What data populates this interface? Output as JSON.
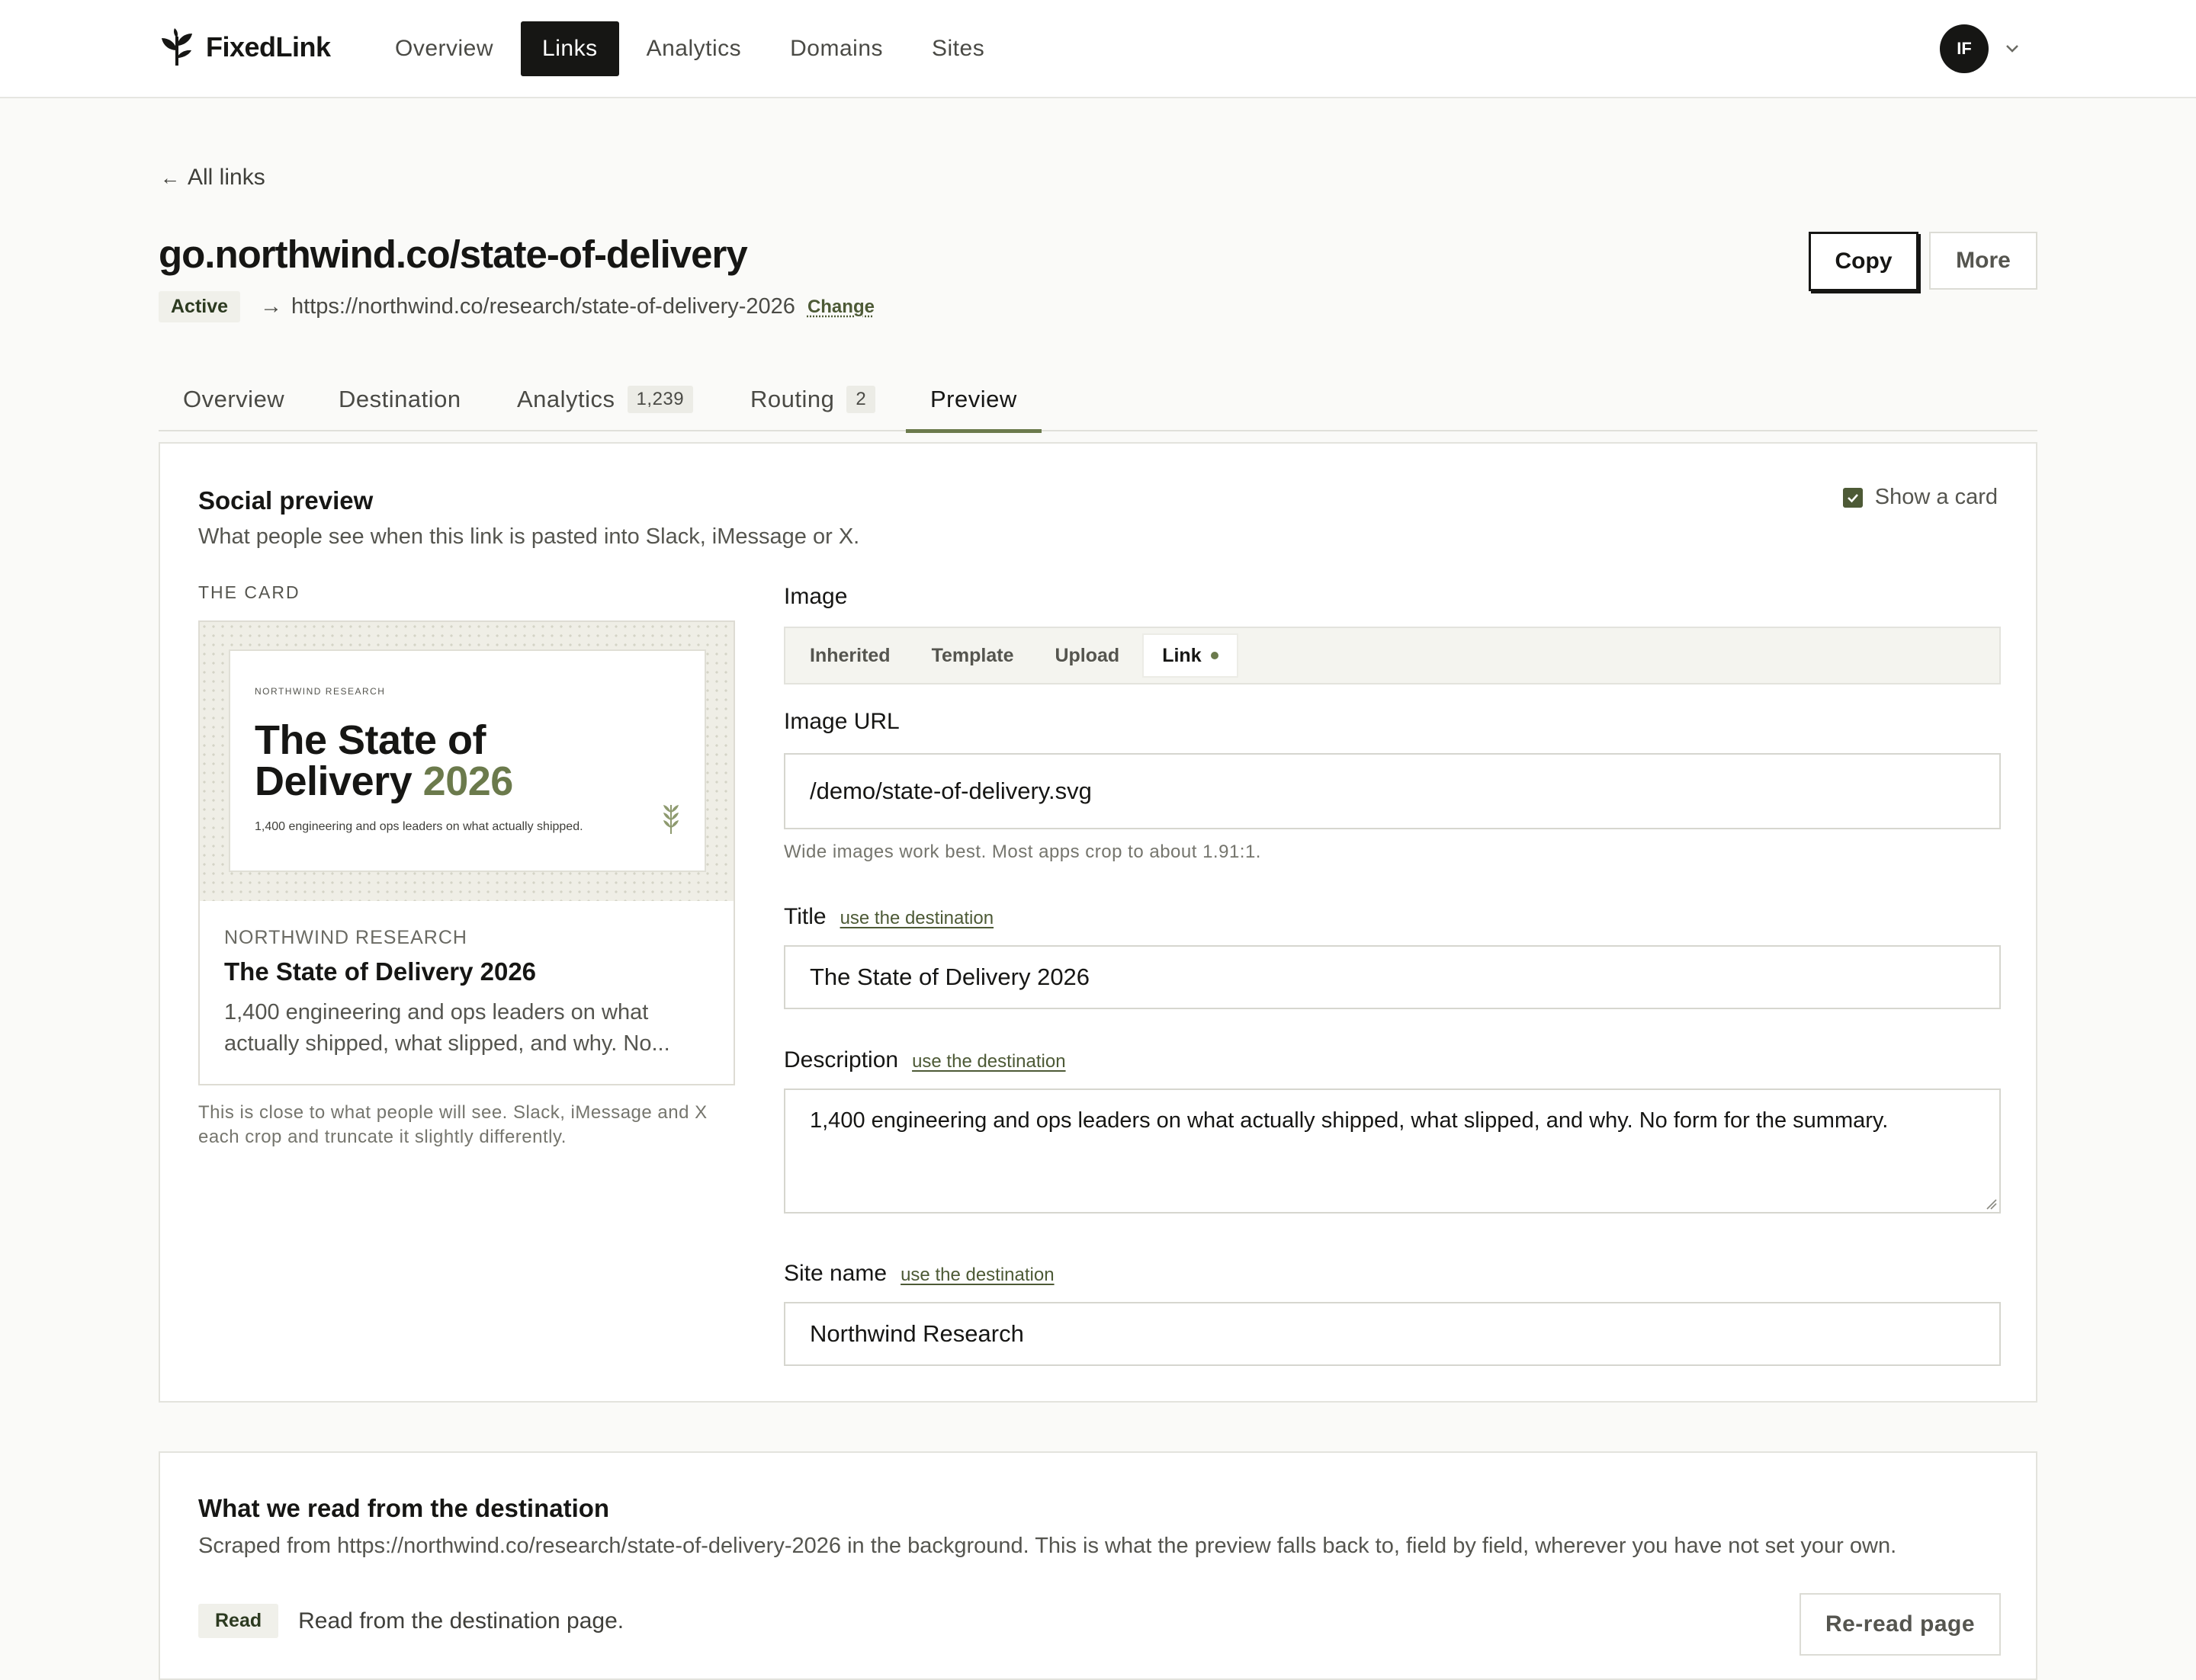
{
  "brand": {
    "name": "FixedLink",
    "accent": "#6b7a4c",
    "dark": "#161614"
  },
  "nav": {
    "items": [
      {
        "label": "Overview",
        "active": false
      },
      {
        "label": "Links",
        "active": true
      },
      {
        "label": "Analytics",
        "active": false
      },
      {
        "label": "Domains",
        "active": false
      },
      {
        "label": "Sites",
        "active": false
      }
    ]
  },
  "user": {
    "initials": "IF"
  },
  "back": {
    "arrow": "←",
    "label": "All links"
  },
  "link": {
    "short_url": "go.northwind.co/state-of-delivery",
    "status": "Active",
    "arrow": "→",
    "destination": "https://northwind.co/research/state-of-delivery-2026",
    "change_label": "Change"
  },
  "actions": {
    "copy": "Copy",
    "more": "More"
  },
  "tabs": [
    {
      "label": "Overview",
      "count": null
    },
    {
      "label": "Destination",
      "count": null
    },
    {
      "label": "Analytics",
      "count": "1,239"
    },
    {
      "label": "Routing",
      "count": "2"
    },
    {
      "label": "Preview",
      "count": null,
      "active": true
    }
  ],
  "social": {
    "title": "Social preview",
    "subtitle": "What people see when this link is pasted into Slack, iMessage or X.",
    "show_card_label": "Show a card",
    "show_card_checked": true,
    "card_label": "THE CARD",
    "card": {
      "image_kicker": "NORTHWIND RESEARCH",
      "image_title_line1": "The State of",
      "image_title_line2": "Delivery",
      "image_title_year": "2026",
      "image_subtitle": "1,400 engineering and ops leaders on what actually shipped.",
      "site": "NORTHWIND RESEARCH",
      "title": "The State of Delivery 2026",
      "description": "1,400 engineering and ops leaders on what actually shipped, what slipped, and why. No..."
    },
    "card_note": "This is close to what people will see. Slack, iMessage and X each crop and truncate it slightly differently.",
    "image_label": "Image",
    "image_sources": [
      {
        "label": "Inherited",
        "active": false
      },
      {
        "label": "Template",
        "active": false
      },
      {
        "label": "Upload",
        "active": false
      },
      {
        "label": "Link",
        "active": true
      }
    ],
    "image_url_label": "Image URL",
    "image_url": "/demo/state-of-delivery.svg",
    "image_hint": "Wide images work best. Most apps crop to about 1.91:1.",
    "title_label": "Title",
    "title_value": "The State of Delivery 2026",
    "description_label": "Description",
    "description_value": "1,400 engineering and ops leaders on what actually shipped, what slipped, and why. No form for the summary.",
    "site_name_label": "Site name",
    "site_name_value": "Northwind Research",
    "use_destination": "use the destination"
  },
  "scraped": {
    "title": "What we read from the destination",
    "subtitle": "Scraped from https://northwind.co/research/state-of-delivery-2026 in the background. This is what the preview falls back to, field by field, wherever you have not set your own.",
    "badge": "Read",
    "status": "Read from the destination page.",
    "reread": "Re-read page"
  }
}
